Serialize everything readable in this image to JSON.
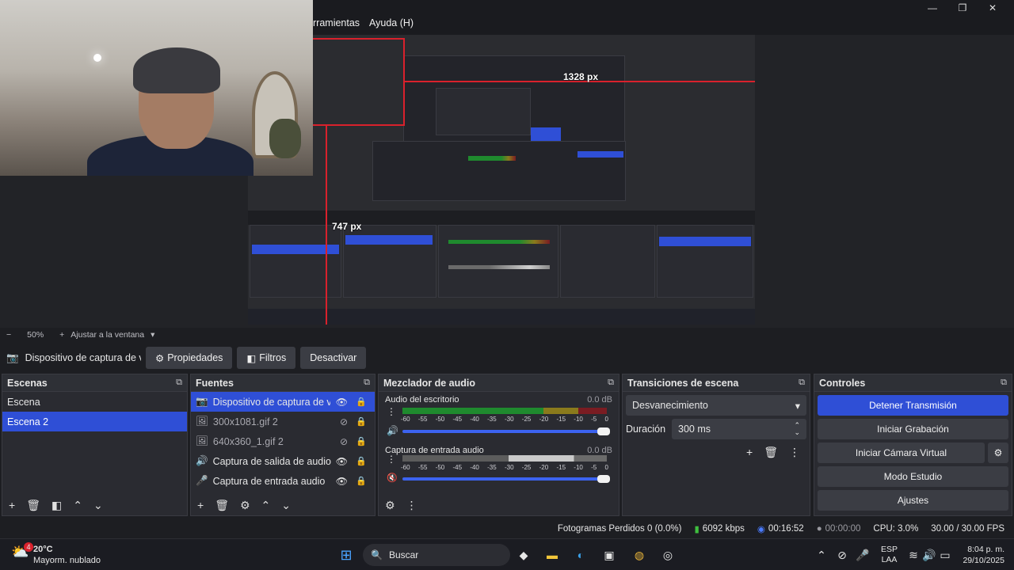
{
  "menu": {
    "items": [
      "rramientas",
      "Ayuda (H)"
    ]
  },
  "window_controls": {
    "minimize": "—",
    "maximize": "❐",
    "close": "✕"
  },
  "preview": {
    "measure_width": "1328 px",
    "measure_height": "747 px"
  },
  "zoombar": {
    "minus": "−",
    "zoom": "50%",
    "plus": "+",
    "fit_label": "Ajustar a la ventana"
  },
  "source_toolbar": {
    "source_name": "Dispositivo de captura de v",
    "properties": "Propiedades",
    "filters": "Filtros",
    "deactivate": "Desactivar"
  },
  "scenes": {
    "title": "Escenas",
    "items": [
      {
        "label": "Escena",
        "selected": false
      },
      {
        "label": "Escena 2",
        "selected": true
      }
    ]
  },
  "sources": {
    "title": "Fuentes",
    "items": [
      {
        "label": "Dispositivo de captura de vídeo",
        "icon": "camera-icon",
        "selected": true
      },
      {
        "label": "300x1081.gif 2",
        "icon": "image-icon",
        "selected": false,
        "hidden": true
      },
      {
        "label": "640x360_1.gif 2",
        "icon": "image-icon",
        "selected": false,
        "hidden": true
      },
      {
        "label": "Captura de salida de audio",
        "icon": "speaker-icon",
        "selected": false
      },
      {
        "label": "Captura de entrada audio",
        "icon": "mic-icon",
        "selected": false
      }
    ]
  },
  "mixer": {
    "title": "Mezclador de audio",
    "ticks": [
      "-60",
      "-55",
      "-50",
      "-45",
      "-40",
      "-35",
      "-30",
      "-25",
      "-20",
      "-15",
      "-10",
      "-5",
      "0"
    ],
    "channels": [
      {
        "name": "Audio del escritorio",
        "db": "0.0 dB"
      },
      {
        "name": "Captura de entrada audio",
        "db": "0.0 dB"
      }
    ]
  },
  "transitions": {
    "title": "Transiciones de escena",
    "selected": "Desvanecimiento",
    "duration_label": "Duración",
    "duration_value": "300 ms"
  },
  "controls": {
    "title": "Controles",
    "stop_stream": "Detener Transmisión",
    "start_recording": "Iniciar Grabación",
    "start_virtual_cam": "Iniciar Cámara Virtual",
    "studio_mode": "Modo Estudio",
    "settings": "Ajustes"
  },
  "status": {
    "dropped": "Fotogramas Perdidos 0 (0.0%)",
    "bitrate": "6092 kbps",
    "stream_time": "00:16:52",
    "rec_time": "00:00:00",
    "cpu": "CPU: 3.0%",
    "fps": "30.00 / 30.00 FPS"
  },
  "taskbar": {
    "weather_temp": "20°C",
    "weather_desc": "Mayorm. nublado",
    "weather_badge": "4",
    "search_label": "Buscar",
    "lang_top": "ESP",
    "lang_bottom": "LAA",
    "time": "8:04 p. m.",
    "date": "29/10/2025"
  },
  "colors": {
    "accent": "#2f4fd6",
    "measure_line": "#d9212c",
    "meter_green": "#1f8a2e",
    "meter_yellow": "#8a7a1c",
    "meter_red": "#7a1c22"
  }
}
